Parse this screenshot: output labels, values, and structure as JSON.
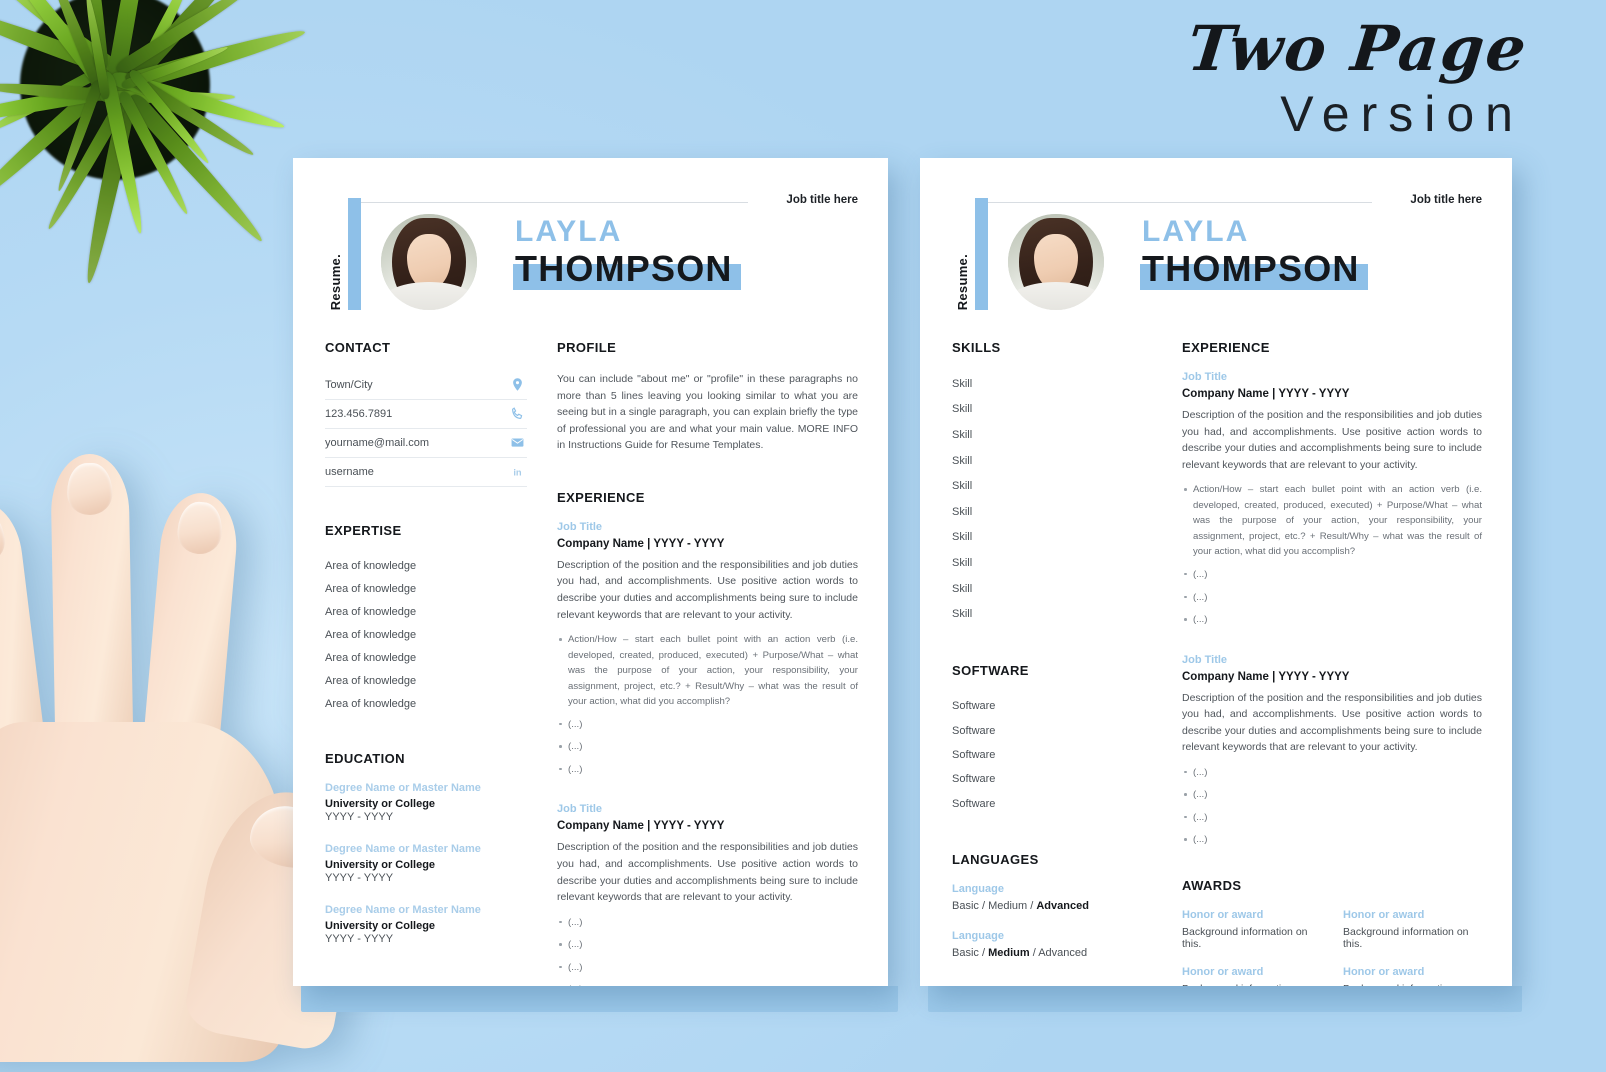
{
  "headline": {
    "line1": "Two Page",
    "line2": "Version"
  },
  "resume": {
    "side_label": "Resume.",
    "job_title_top": "Job title here",
    "name_first": "LAYLA",
    "name_last": "THOMPSON",
    "accent_blue": "#8ec0e8",
    "background_blue": "#b9dcf5"
  },
  "page1": {
    "contact": {
      "heading": "CONTACT",
      "rows": [
        {
          "text": "Town/City",
          "icon": "location-pin-icon"
        },
        {
          "text": "123.456.7891",
          "icon": "phone-icon"
        },
        {
          "text": "yourname@mail.com",
          "icon": "envelope-icon"
        },
        {
          "text": "username",
          "icon": "linkedin-icon"
        }
      ]
    },
    "expertise": {
      "heading": "EXPERTISE",
      "items": [
        "Area of knowledge",
        "Area of knowledge",
        "Area of knowledge",
        "Area of knowledge",
        "Area of knowledge",
        "Area of knowledge",
        "Area of knowledge"
      ]
    },
    "education": {
      "heading": "EDUCATION",
      "items": [
        {
          "degree": "Degree Name or Master Name",
          "school": "University or College",
          "years": "YYYY - YYYY"
        },
        {
          "degree": "Degree Name or Master Name",
          "school": "University or College",
          "years": "YYYY - YYYY"
        },
        {
          "degree": "Degree Name or Master Name",
          "school": "University or College",
          "years": "YYYY - YYYY"
        }
      ]
    },
    "profile": {
      "heading": "PROFILE",
      "text": "You can include \"about me\" or \"profile\" in these paragraphs no more than 5 lines leaving you looking similar to what you are seeing but in a single paragraph, you can explain briefly the type of professional you are and what your main value. MORE INFO in Instructions Guide for Resume Templates."
    },
    "experience": {
      "heading": "EXPERIENCE",
      "jobs": [
        {
          "job_title": "Job Title",
          "company_line": "Company Name | YYYY - YYYY",
          "description": "Description of the position and the responsibilities and job duties you had, and accomplishments. Use positive action words to describe your duties and accomplishments being sure to include relevant keywords that are relevant to your activity.",
          "bullets": [
            "Action/How – start each bullet point with an action verb (i.e. developed, created, produced, executed) + Purpose/What – what was the purpose of your action, your responsibility, your assignment, project, etc.? + Result/Why – what was the result of your action, what did you accomplish?",
            "(...)",
            "(...)",
            "(...)"
          ]
        },
        {
          "job_title": "Job Title",
          "company_line": "Company Name | YYYY - YYYY",
          "description": "Description of the position and the responsibilities and job duties you had, and accomplishments. Use positive action words to describe your duties and accomplishments being sure to include relevant keywords that are relevant to your activity.",
          "bullets": [
            "(...)",
            "(...)",
            "(...)",
            "(...)"
          ]
        }
      ]
    }
  },
  "page2": {
    "skills": {
      "heading": "SKILLS",
      "items": [
        "Skill",
        "Skill",
        "Skill",
        "Skill",
        "Skill",
        "Skill",
        "Skill",
        "Skill",
        "Skill",
        "Skill"
      ]
    },
    "software": {
      "heading": "SOFTWARE",
      "items": [
        "Software",
        "Software",
        "Software",
        "Software",
        "Software"
      ]
    },
    "languages": {
      "heading": "LANGUAGES",
      "items": [
        {
          "name": "Language",
          "pre": "Basic / Medium / ",
          "strong": "Advanced",
          "post": ""
        },
        {
          "name": "Language",
          "pre": "Basic / ",
          "strong": "Medium",
          "post": " / Advanced"
        }
      ]
    },
    "awards": {
      "heading": "AWARDS",
      "items": [
        {
          "name": "Honor or award",
          "desc": "Background information on this."
        },
        {
          "name": "Honor or award",
          "desc": "Background information on this."
        },
        {
          "name": "Honor or award",
          "desc": "Background information on this."
        },
        {
          "name": "Honor or award",
          "desc": "Background information on this."
        }
      ]
    },
    "experience": {
      "heading": "EXPERIENCE",
      "jobs": [
        {
          "job_title": "Job Title",
          "company_line": "Company Name | YYYY - YYYY",
          "description": "Description of the position and the responsibilities and job duties you had, and accomplishments. Use positive action words to describe your duties and accomplishments being sure to include relevant keywords that are relevant to your activity.",
          "bullets": [
            "Action/How – start each bullet point with an action verb (i.e. developed, created, produced, executed) + Purpose/What – what was the purpose of your action, your responsibility, your assignment, project, etc.? + Result/Why – what was the result of your action, what did you accomplish?",
            "(...)",
            "(...)",
            "(...)"
          ]
        },
        {
          "job_title": "Job Title",
          "company_line": "Company Name | YYYY - YYYY",
          "description": "Description of the position and the responsibilities and job duties you had, and accomplishments. Use positive action words to describe your duties and accomplishments being sure to include relevant keywords that are relevant to your activity.",
          "bullets": [
            "(...)",
            "(...)",
            "(...)",
            "(...)"
          ]
        }
      ]
    }
  }
}
